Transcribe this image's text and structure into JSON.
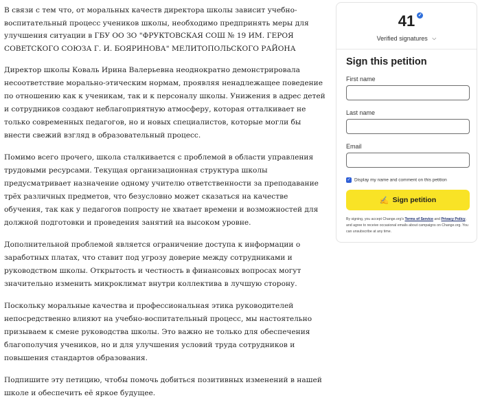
{
  "article": {
    "paragraphs": [
      "В связи с тем что, от моральных качеств директора школы зависит учебно-воспитательный процесс учеников школы, необходимо предпринять меры для улучшения ситуации в ГБУ ОО ЗО \"ФРУКТОВСКАЯ СОШ № 19 ИМ. ГЕРОЯ СОВЕТСКОГО СОЮЗА Г. И. БОЯРИНОВА\" МЕЛИТОПОЛЬСКОГО РАЙОНА",
      "Директор школы Коваль Ирина Валерьевна неоднократно демонстрировала несоответствие морально-этическим нормам, проявляя ненадлежащее поведение по отношению как к ученикам, так и к персоналу школы. Унижения в адрес детей и сотрудников создают неблагоприятную атмосферу, которая отталкивает не только современных педагогов, но и новых специалистов, которые могли бы внести свежий взгляд в образовательный процесс.",
      "Помимо всего прочего, школа сталкивается с проблемой в области управления трудовыми ресурсами. Текущая организационная структура школы предусматривает назначение одному учителю ответственности за преподавание трёх различных предметов, что безусловно может сказаться на качестве обучения, так как у педагогов попросту не хватает времени и возможностей для должной подготовки и проведения занятий на высоком уровне.",
      "Дополнительной проблемой является ограничение доступа к информации о заработных платах, что ставит под угрозу доверие между сотрудниками и руководством школы. Открытость и честность в финансовых вопросах могут значительно изменить микроклимат внутри коллектива в лучшую сторону.",
      "Поскольку моральные качества и профессиональная этика руководителей непосредственно влияют на учебно-воспитательный процесс, мы настоятельно призываем к смене руководства школы. Это важно не только для обеспечения благополучия учеников, но и для улучшения условий труда сотрудников и повышения стандартов образования.",
      "Подпишите эту петицию, чтобы помочь добиться позитивных изменений в нашей школе и обеспечить её яркое будущее."
    ]
  },
  "sidebar": {
    "signature_count": "41",
    "verified_label": "Verified signatures",
    "verified_icon": "verified-check-icon",
    "chevron_icon": "chevron-down-icon",
    "title": "Sign this petition",
    "fields": {
      "first_name": {
        "label": "First name",
        "value": ""
      },
      "last_name": {
        "label": "Last name",
        "value": ""
      },
      "email": {
        "label": "Email",
        "value": ""
      }
    },
    "display_checkbox": {
      "label": "Display my name and comment on this petition",
      "checked": true
    },
    "sign_button": {
      "label": "Sign petition",
      "icon": "pen-icon"
    },
    "legal": {
      "prefix": "By signing, you accept Change.org's ",
      "terms": "Terms of Service",
      "and": " and ",
      "privacy": "Privacy Policy",
      "suffix": ", and agree to receive occasional emails about campaigns on Change.org. You can unsubscribe at any time."
    }
  },
  "colors": {
    "button": "#f9e326",
    "verified_badge": "#2f6fdb",
    "checkbox": "#2f5fd6",
    "link": "#1a2b6b"
  }
}
